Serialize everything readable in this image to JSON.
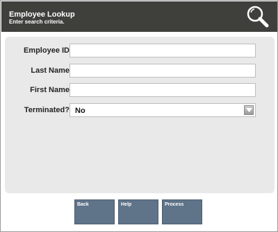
{
  "header": {
    "title": "Employee Lookup",
    "subtitle": "Enter search criteria."
  },
  "form": {
    "employee_id_label": "Employee ID",
    "employee_id_value": "",
    "last_name_label": "Last Name",
    "last_name_value": "",
    "first_name_label": "First Name",
    "first_name_value": "",
    "terminated_label": "Terminated?",
    "terminated_value": "No"
  },
  "buttons": {
    "back": "Back",
    "help": "Help",
    "process": "Process"
  },
  "colors": {
    "titlebar": "#3f3f3c",
    "button": "#5f7389",
    "content_bg": "#e9e9e9"
  },
  "icons": {
    "search": "magnifier-icon",
    "dropdown": "chevron-down-icon"
  }
}
